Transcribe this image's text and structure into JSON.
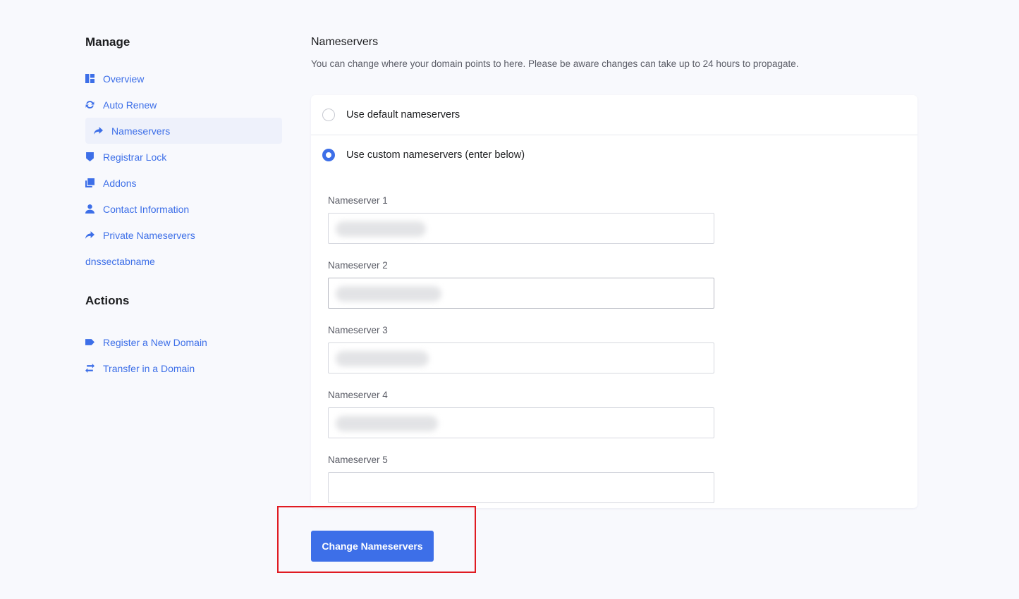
{
  "sidebar": {
    "manage_title": "Manage",
    "manage_items": [
      {
        "label": "Overview",
        "icon": "dashboard-icon"
      },
      {
        "label": "Auto Renew",
        "icon": "sync-icon"
      },
      {
        "label": "Nameservers",
        "icon": "share-arrow-icon",
        "active": true
      },
      {
        "label": "Registrar Lock",
        "icon": "shield-icon"
      },
      {
        "label": "Addons",
        "icon": "addons-icon"
      },
      {
        "label": "Contact Information",
        "icon": "user-icon"
      },
      {
        "label": "Private Nameservers",
        "icon": "share-arrow-icon"
      },
      {
        "label": "dnssectabname"
      }
    ],
    "actions_title": "Actions",
    "action_items": [
      {
        "label": "Register a New Domain",
        "icon": "tag-icon"
      },
      {
        "label": "Transfer in a Domain",
        "icon": "exchange-icon"
      }
    ]
  },
  "main": {
    "title": "Nameservers",
    "description": "You can change where your domain points to here. Please be aware changes can take up to 24 hours to propagate.",
    "options": {
      "default_label": "Use default nameservers",
      "custom_label": "Use custom nameservers (enter below)",
      "selected": "custom"
    },
    "fields": [
      {
        "label": "Nameserver 1",
        "value": ""
      },
      {
        "label": "Nameserver 2",
        "value": ""
      },
      {
        "label": "Nameserver 3",
        "value": ""
      },
      {
        "label": "Nameserver 4",
        "value": ""
      },
      {
        "label": "Nameserver 5",
        "value": ""
      }
    ],
    "submit_label": "Change Nameservers"
  },
  "colors": {
    "accent": "#3d6fe8",
    "highlight_border": "#e01b22",
    "background": "#f8f9fd"
  }
}
